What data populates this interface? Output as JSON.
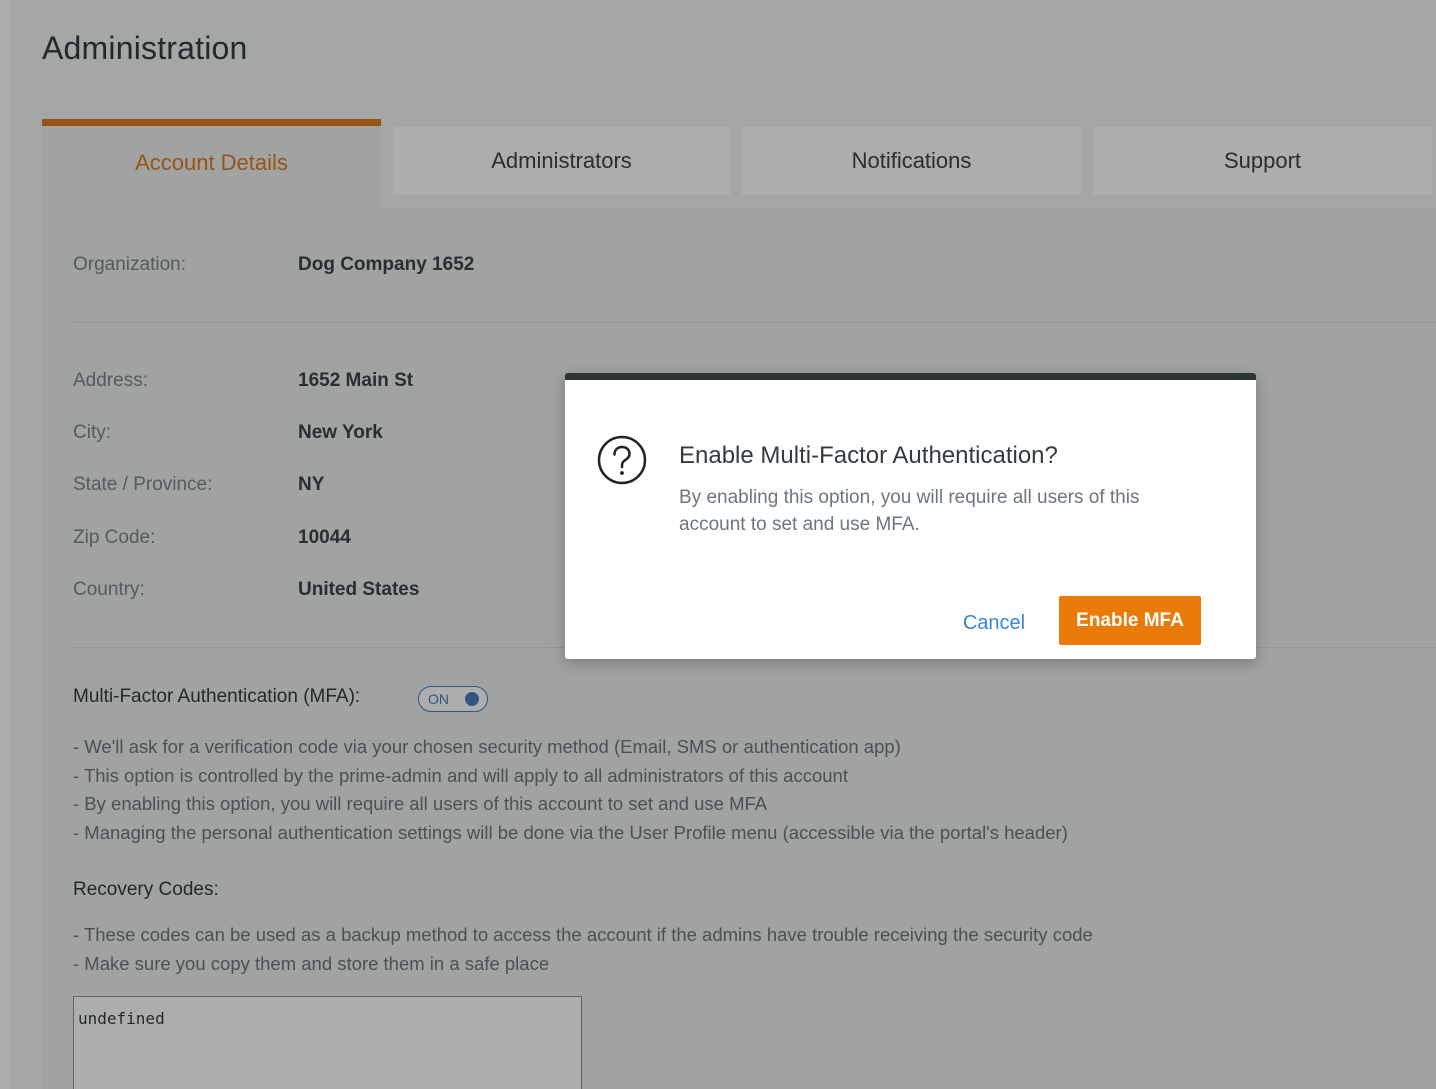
{
  "page": {
    "title": "Administration"
  },
  "tabs": [
    {
      "label": "Account Details",
      "active": true
    },
    {
      "label": "Administrators",
      "active": false
    },
    {
      "label": "Notifications",
      "active": false
    },
    {
      "label": "Support",
      "active": false
    }
  ],
  "account": {
    "organization": {
      "label": "Organization:",
      "value": "Dog Company 1652"
    },
    "address": {
      "label": "Address:",
      "value": "1652 Main St"
    },
    "city": {
      "label": "City:",
      "value": "New York"
    },
    "state": {
      "label": "State / Province:",
      "value": "NY"
    },
    "zip": {
      "label": "Zip Code:",
      "value": "10044"
    },
    "country": {
      "label": "Country:",
      "value": "United States"
    }
  },
  "mfa": {
    "label": "Multi-Factor Authentication (MFA):",
    "toggle_text": "ON",
    "toggle_on": true,
    "bullets": [
      "- We'll ask for a verification code via your chosen security method (Email, SMS or authentication app)",
      "- This option is controlled by the prime-admin and will apply to all administrators of this account",
      "- By enabling this option, you will require all users of this account to set and use MFA",
      "- Managing the personal authentication settings will be done via the User Profile menu (accessible via the portal's header)"
    ]
  },
  "recovery": {
    "label": "Recovery Codes:",
    "bullets": [
      "- These codes can be used as a backup method to access the account if the admins have trouble receiving the security code",
      "- Make sure you copy them and store them in a safe place"
    ],
    "codes_value": "undefined"
  },
  "modal": {
    "icon": "question-circle-icon",
    "title": "Enable Multi-Factor Authentication?",
    "body": "By enabling this option, you will require all users of this account to set and use MFA.",
    "cancel_label": "Cancel",
    "confirm_label": "Enable MFA"
  },
  "colors": {
    "accent": "#ec7a08",
    "active_tab_text": "#e07d1e",
    "link": "#3a86d6",
    "toggle": "#4a7fc1",
    "modal_top_border": "#2e3336"
  }
}
